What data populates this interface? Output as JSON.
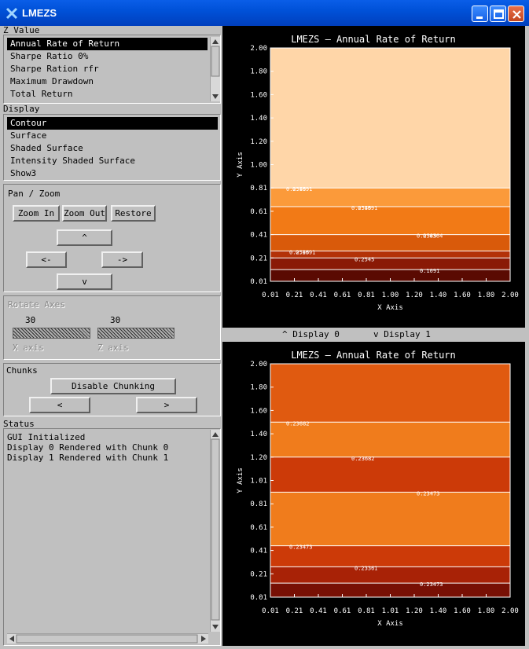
{
  "window": {
    "title": "LMEZS"
  },
  "zvalue": {
    "label": "Z Value",
    "items": [
      "Annual Rate of Return",
      "Sharpe Ratio 0%",
      "Sharpe Ration rfr",
      "Maximum Drawdown",
      "Total Return"
    ]
  },
  "display": {
    "label": "Display",
    "items": [
      "Contour",
      "Surface",
      "Shaded Surface",
      "Intensity Shaded Surface",
      "Show3"
    ]
  },
  "panzoom": {
    "label": "Pan / Zoom",
    "zoom_in": "Zoom In",
    "zoom_out": "Zoom Out",
    "restore": "Restore",
    "up": "^",
    "left": "<-",
    "right": "->",
    "down": "v"
  },
  "rotate": {
    "label": "Rotate Axes",
    "x_value": "30",
    "z_value": "30",
    "x_label": "X axis",
    "z_label": "Z axis"
  },
  "chunks": {
    "label": "Chunks",
    "disable": "Disable Chunking",
    "prev": "<",
    "next": ">"
  },
  "status": {
    "label": "Status",
    "lines": [
      "GUI Initialized",
      "Display 0 Rendered with Chunk 0",
      "Display 1 Rendered with Chunk 1"
    ]
  },
  "switcher": {
    "up": "^ Display 0",
    "down": "v Display 1"
  },
  "plots": [
    {
      "title": "LMEZS — Annual Rate of Return",
      "xlabel": "X Axis",
      "ylabel": "Y Axis",
      "xticks": [
        "0.01",
        "0.21",
        "0.41",
        "0.61",
        "0.81",
        "1.00",
        "1.20",
        "1.40",
        "1.60",
        "1.80",
        "2.00"
      ],
      "yticks": [
        "0.01",
        "0.21",
        "0.41",
        "0.61",
        "0.81",
        "1.00",
        "1.20",
        "1.40",
        "1.60",
        "1.80",
        "2.00"
      ],
      "contour_labels": [
        "0.2545",
        "0.2545",
        "0.2545",
        "0.2545",
        "0.2545",
        "0.1091",
        "0.1091",
        "0.1091",
        "0.0364",
        "0.1091"
      ],
      "colors": [
        "#ffd6a8",
        "#fcb56a",
        "#fb9a3a",
        "#f27a16",
        "#d95a0a",
        "#b33208",
        "#8a1a06",
        "#5a0a02"
      ]
    },
    {
      "title": "LMEZS — Annual Rate of Return",
      "xlabel": "X Axis",
      "ylabel": "Y Axis",
      "xticks": [
        "0.01",
        "0.21",
        "0.41",
        "0.61",
        "0.81",
        "1.01",
        "1.20",
        "1.40",
        "1.60",
        "1.80",
        "2.00"
      ],
      "yticks": [
        "0.01",
        "0.21",
        "0.41",
        "0.61",
        "0.81",
        "1.01",
        "1.20",
        "1.40",
        "1.60",
        "1.80",
        "2.00"
      ],
      "contour_labels": [
        "0.23682",
        "0.23682",
        "0.23473",
        "0.23473",
        "0.23361",
        "0.23473"
      ],
      "colors": [
        "#f79a30",
        "#f07c1c",
        "#e05a10",
        "#cc3a08",
        "#a82206",
        "#781004",
        "#400400"
      ]
    }
  ]
}
